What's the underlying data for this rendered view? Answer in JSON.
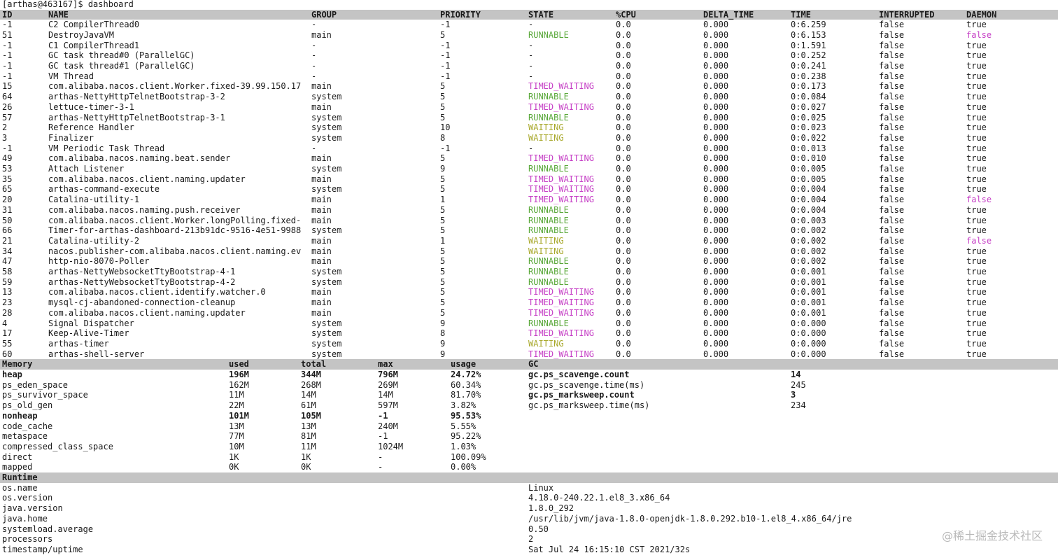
{
  "prompt": "[arthas@463167]$ dashboard",
  "watermark": "@稀土掘金技术社区",
  "colors": {
    "header_band": "#c4c4c4",
    "runnable": "#5aa83a",
    "timed_waiting": "#c640c6",
    "waiting": "#a8a82a",
    "daemon_false": "#c640c6"
  },
  "threads": {
    "headers": [
      "ID",
      "NAME",
      "GROUP",
      "PRIORITY",
      "STATE",
      "%CPU",
      "DELTA_TIME",
      "TIME",
      "INTERRUPTED",
      "DAEMON"
    ],
    "rows": [
      [
        "-1",
        "C2 CompilerThread0",
        "-",
        "-1",
        "-",
        "0.0",
        "0.000",
        "0:6.259",
        "false",
        "true"
      ],
      [
        "51",
        "DestroyJavaVM",
        "main",
        "5",
        "RUNNABLE",
        "0.0",
        "0.000",
        "0:6.153",
        "false",
        "false"
      ],
      [
        "-1",
        "C1 CompilerThread1",
        "-",
        "-1",
        "-",
        "0.0",
        "0.000",
        "0:1.591",
        "false",
        "true"
      ],
      [
        "-1",
        "GC task thread#0 (ParallelGC)",
        "-",
        "-1",
        "-",
        "0.0",
        "0.000",
        "0:0.252",
        "false",
        "true"
      ],
      [
        "-1",
        "GC task thread#1 (ParallelGC)",
        "-",
        "-1",
        "-",
        "0.0",
        "0.000",
        "0:0.241",
        "false",
        "true"
      ],
      [
        "-1",
        "VM Thread",
        "-",
        "-1",
        "-",
        "0.0",
        "0.000",
        "0:0.238",
        "false",
        "true"
      ],
      [
        "15",
        "com.alibaba.nacos.client.Worker.fixed-39.99.150.17",
        "main",
        "5",
        "TIMED_WAITING",
        "0.0",
        "0.000",
        "0:0.173",
        "false",
        "true"
      ],
      [
        "64",
        "arthas-NettyHttpTelnetBootstrap-3-2",
        "system",
        "5",
        "RUNNABLE",
        "0.0",
        "0.000",
        "0:0.084",
        "false",
        "true"
      ],
      [
        "26",
        "lettuce-timer-3-1",
        "main",
        "5",
        "TIMED_WAITING",
        "0.0",
        "0.000",
        "0:0.027",
        "false",
        "true"
      ],
      [
        "57",
        "arthas-NettyHttpTelnetBootstrap-3-1",
        "system",
        "5",
        "RUNNABLE",
        "0.0",
        "0.000",
        "0:0.025",
        "false",
        "true"
      ],
      [
        "2",
        "Reference Handler",
        "system",
        "10",
        "WAITING",
        "0.0",
        "0.000",
        "0:0.023",
        "false",
        "true"
      ],
      [
        "3",
        "Finalizer",
        "system",
        "8",
        "WAITING",
        "0.0",
        "0.000",
        "0:0.022",
        "false",
        "true"
      ],
      [
        "-1",
        "VM Periodic Task Thread",
        "-",
        "-1",
        "-",
        "0.0",
        "0.000",
        "0:0.013",
        "false",
        "true"
      ],
      [
        "49",
        "com.alibaba.nacos.naming.beat.sender",
        "main",
        "5",
        "TIMED_WAITING",
        "0.0",
        "0.000",
        "0:0.010",
        "false",
        "true"
      ],
      [
        "53",
        "Attach Listener",
        "system",
        "9",
        "RUNNABLE",
        "0.0",
        "0.000",
        "0:0.005",
        "false",
        "true"
      ],
      [
        "35",
        "com.alibaba.nacos.client.naming.updater",
        "main",
        "5",
        "TIMED_WAITING",
        "0.0",
        "0.000",
        "0:0.005",
        "false",
        "true"
      ],
      [
        "65",
        "arthas-command-execute",
        "system",
        "5",
        "TIMED_WAITING",
        "0.0",
        "0.000",
        "0:0.004",
        "false",
        "true"
      ],
      [
        "20",
        "Catalina-utility-1",
        "main",
        "1",
        "TIMED_WAITING",
        "0.0",
        "0.000",
        "0:0.004",
        "false",
        "false"
      ],
      [
        "31",
        "com.alibaba.nacos.naming.push.receiver",
        "main",
        "5",
        "RUNNABLE",
        "0.0",
        "0.000",
        "0:0.004",
        "false",
        "true"
      ],
      [
        "50",
        "com.alibaba.nacos.client.Worker.longPolling.fixed-",
        "main",
        "5",
        "RUNNABLE",
        "0.0",
        "0.000",
        "0:0.003",
        "false",
        "true"
      ],
      [
        "66",
        "Timer-for-arthas-dashboard-213b91dc-9516-4e51-9988",
        "system",
        "5",
        "RUNNABLE",
        "0.0",
        "0.000",
        "0:0.002",
        "false",
        "true"
      ],
      [
        "21",
        "Catalina-utility-2",
        "main",
        "1",
        "WAITING",
        "0.0",
        "0.000",
        "0:0.002",
        "false",
        "false"
      ],
      [
        "34",
        "nacos.publisher-com.alibaba.nacos.client.naming.ev",
        "main",
        "5",
        "WAITING",
        "0.0",
        "0.000",
        "0:0.002",
        "false",
        "true"
      ],
      [
        "47",
        "http-nio-8070-Poller",
        "main",
        "5",
        "RUNNABLE",
        "0.0",
        "0.000",
        "0:0.002",
        "false",
        "true"
      ],
      [
        "58",
        "arthas-NettyWebsocketTtyBootstrap-4-1",
        "system",
        "5",
        "RUNNABLE",
        "0.0",
        "0.000",
        "0:0.001",
        "false",
        "true"
      ],
      [
        "59",
        "arthas-NettyWebsocketTtyBootstrap-4-2",
        "system",
        "5",
        "RUNNABLE",
        "0.0",
        "0.000",
        "0:0.001",
        "false",
        "true"
      ],
      [
        "13",
        "com.alibaba.nacos.client.identify.watcher.0",
        "main",
        "5",
        "TIMED_WAITING",
        "0.0",
        "0.000",
        "0:0.001",
        "false",
        "true"
      ],
      [
        "23",
        "mysql-cj-abandoned-connection-cleanup",
        "main",
        "5",
        "TIMED_WAITING",
        "0.0",
        "0.000",
        "0:0.001",
        "false",
        "true"
      ],
      [
        "28",
        "com.alibaba.nacos.client.naming.updater",
        "main",
        "5",
        "TIMED_WAITING",
        "0.0",
        "0.000",
        "0:0.001",
        "false",
        "true"
      ],
      [
        "4",
        "Signal Dispatcher",
        "system",
        "9",
        "RUNNABLE",
        "0.0",
        "0.000",
        "0:0.000",
        "false",
        "true"
      ],
      [
        "17",
        "Keep-Alive-Timer",
        "system",
        "8",
        "TIMED_WAITING",
        "0.0",
        "0.000",
        "0:0.000",
        "false",
        "true"
      ],
      [
        "55",
        "arthas-timer",
        "system",
        "9",
        "WAITING",
        "0.0",
        "0.000",
        "0:0.000",
        "false",
        "true"
      ],
      [
        "60",
        "arthas-shell-server",
        "system",
        "9",
        "TIMED_WAITING",
        "0.0",
        "0.000",
        "0:0.000",
        "false",
        "true"
      ]
    ]
  },
  "memory": {
    "headers": [
      "Memory",
      "used",
      "total",
      "max",
      "usage"
    ],
    "rows": [
      {
        "cells": [
          "heap",
          "196M",
          "344M",
          "796M",
          "24.72%"
        ],
        "bold": true
      },
      {
        "cells": [
          "ps_eden_space",
          "162M",
          "268M",
          "269M",
          "60.34%"
        ],
        "bold": false
      },
      {
        "cells": [
          "ps_survivor_space",
          "11M",
          "14M",
          "14M",
          "81.70%"
        ],
        "bold": false
      },
      {
        "cells": [
          "ps_old_gen",
          "22M",
          "61M",
          "597M",
          "3.82%"
        ],
        "bold": false
      },
      {
        "cells": [
          "nonheap",
          "101M",
          "105M",
          "-1",
          "95.53%"
        ],
        "bold": true
      },
      {
        "cells": [
          "code_cache",
          "13M",
          "13M",
          "240M",
          "5.55%"
        ],
        "bold": false
      },
      {
        "cells": [
          "metaspace",
          "77M",
          "81M",
          "-1",
          "95.22%"
        ],
        "bold": false
      },
      {
        "cells": [
          "compressed_class_space",
          "10M",
          "11M",
          "1024M",
          "1.03%"
        ],
        "bold": false
      },
      {
        "cells": [
          "direct",
          "1K",
          "1K",
          "-",
          "100.09%"
        ],
        "bold": false
      },
      {
        "cells": [
          "mapped",
          "0K",
          "0K",
          "-",
          "0.00%"
        ],
        "bold": false
      }
    ]
  },
  "gc": {
    "header": "GC",
    "rows": [
      {
        "cells": [
          "gc.ps_scavenge.count",
          "14"
        ],
        "bold": true
      },
      {
        "cells": [
          "gc.ps_scavenge.time(ms)",
          "245"
        ],
        "bold": false
      },
      {
        "cells": [
          "gc.ps_marksweep.count",
          "3"
        ],
        "bold": true
      },
      {
        "cells": [
          "gc.ps_marksweep.time(ms)",
          "234"
        ],
        "bold": false
      }
    ]
  },
  "runtime": {
    "header": "Runtime",
    "rows": [
      [
        "os.name",
        "Linux"
      ],
      [
        "os.version",
        "4.18.0-240.22.1.el8_3.x86_64"
      ],
      [
        "java.version",
        "1.8.0_292"
      ],
      [
        "java.home",
        "/usr/lib/jvm/java-1.8.0-openjdk-1.8.0.292.b10-1.el8_4.x86_64/jre"
      ],
      [
        "systemload.average",
        "0.50"
      ],
      [
        "processors",
        "2"
      ],
      [
        "timestamp/uptime",
        "Sat Jul 24 16:15:10 CST 2021/32s"
      ]
    ]
  }
}
